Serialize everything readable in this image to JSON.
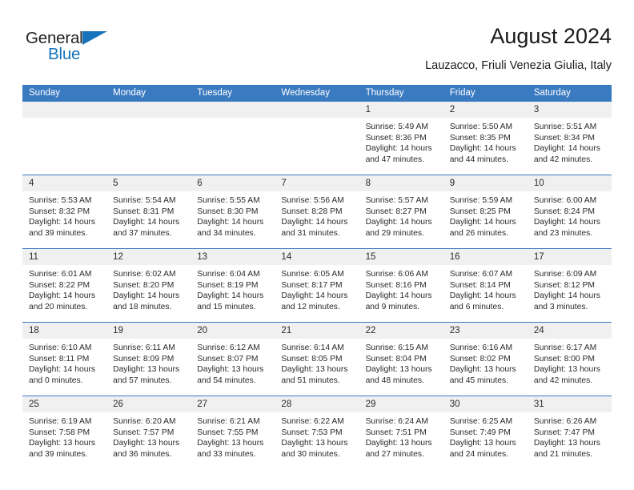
{
  "brand": {
    "name_part1": "General",
    "name_part2": "Blue",
    "accent_color": "#1473bb"
  },
  "header": {
    "title": "August 2024",
    "subtitle": "Lauzacco, Friuli Venezia Giulia, Italy"
  },
  "calendar": {
    "header_color": "#3a7ac0",
    "weekdays": [
      "Sunday",
      "Monday",
      "Tuesday",
      "Wednesday",
      "Thursday",
      "Friday",
      "Saturday"
    ],
    "labels": {
      "sunrise": "Sunrise:",
      "sunset": "Sunset:",
      "daylight": "Daylight:"
    },
    "weeks": [
      [
        {
          "date": "",
          "empty": true
        },
        {
          "date": "",
          "empty": true
        },
        {
          "date": "",
          "empty": true
        },
        {
          "date": "",
          "empty": true
        },
        {
          "date": "1",
          "sunrise": "Sunrise: 5:49 AM",
          "sunset": "Sunset: 8:36 PM",
          "daylight": "Daylight: 14 hours and 47 minutes."
        },
        {
          "date": "2",
          "sunrise": "Sunrise: 5:50 AM",
          "sunset": "Sunset: 8:35 PM",
          "daylight": "Daylight: 14 hours and 44 minutes."
        },
        {
          "date": "3",
          "sunrise": "Sunrise: 5:51 AM",
          "sunset": "Sunset: 8:34 PM",
          "daylight": "Daylight: 14 hours and 42 minutes."
        }
      ],
      [
        {
          "date": "4",
          "sunrise": "Sunrise: 5:53 AM",
          "sunset": "Sunset: 8:32 PM",
          "daylight": "Daylight: 14 hours and 39 minutes."
        },
        {
          "date": "5",
          "sunrise": "Sunrise: 5:54 AM",
          "sunset": "Sunset: 8:31 PM",
          "daylight": "Daylight: 14 hours and 37 minutes."
        },
        {
          "date": "6",
          "sunrise": "Sunrise: 5:55 AM",
          "sunset": "Sunset: 8:30 PM",
          "daylight": "Daylight: 14 hours and 34 minutes."
        },
        {
          "date": "7",
          "sunrise": "Sunrise: 5:56 AM",
          "sunset": "Sunset: 8:28 PM",
          "daylight": "Daylight: 14 hours and 31 minutes."
        },
        {
          "date": "8",
          "sunrise": "Sunrise: 5:57 AM",
          "sunset": "Sunset: 8:27 PM",
          "daylight": "Daylight: 14 hours and 29 minutes."
        },
        {
          "date": "9",
          "sunrise": "Sunrise: 5:59 AM",
          "sunset": "Sunset: 8:25 PM",
          "daylight": "Daylight: 14 hours and 26 minutes."
        },
        {
          "date": "10",
          "sunrise": "Sunrise: 6:00 AM",
          "sunset": "Sunset: 8:24 PM",
          "daylight": "Daylight: 14 hours and 23 minutes."
        }
      ],
      [
        {
          "date": "11",
          "sunrise": "Sunrise: 6:01 AM",
          "sunset": "Sunset: 8:22 PM",
          "daylight": "Daylight: 14 hours and 20 minutes."
        },
        {
          "date": "12",
          "sunrise": "Sunrise: 6:02 AM",
          "sunset": "Sunset: 8:20 PM",
          "daylight": "Daylight: 14 hours and 18 minutes."
        },
        {
          "date": "13",
          "sunrise": "Sunrise: 6:04 AM",
          "sunset": "Sunset: 8:19 PM",
          "daylight": "Daylight: 14 hours and 15 minutes."
        },
        {
          "date": "14",
          "sunrise": "Sunrise: 6:05 AM",
          "sunset": "Sunset: 8:17 PM",
          "daylight": "Daylight: 14 hours and 12 minutes."
        },
        {
          "date": "15",
          "sunrise": "Sunrise: 6:06 AM",
          "sunset": "Sunset: 8:16 PM",
          "daylight": "Daylight: 14 hours and 9 minutes."
        },
        {
          "date": "16",
          "sunrise": "Sunrise: 6:07 AM",
          "sunset": "Sunset: 8:14 PM",
          "daylight": "Daylight: 14 hours and 6 minutes."
        },
        {
          "date": "17",
          "sunrise": "Sunrise: 6:09 AM",
          "sunset": "Sunset: 8:12 PM",
          "daylight": "Daylight: 14 hours and 3 minutes."
        }
      ],
      [
        {
          "date": "18",
          "sunrise": "Sunrise: 6:10 AM",
          "sunset": "Sunset: 8:11 PM",
          "daylight": "Daylight: 14 hours and 0 minutes."
        },
        {
          "date": "19",
          "sunrise": "Sunrise: 6:11 AM",
          "sunset": "Sunset: 8:09 PM",
          "daylight": "Daylight: 13 hours and 57 minutes."
        },
        {
          "date": "20",
          "sunrise": "Sunrise: 6:12 AM",
          "sunset": "Sunset: 8:07 PM",
          "daylight": "Daylight: 13 hours and 54 minutes."
        },
        {
          "date": "21",
          "sunrise": "Sunrise: 6:14 AM",
          "sunset": "Sunset: 8:05 PM",
          "daylight": "Daylight: 13 hours and 51 minutes."
        },
        {
          "date": "22",
          "sunrise": "Sunrise: 6:15 AM",
          "sunset": "Sunset: 8:04 PM",
          "daylight": "Daylight: 13 hours and 48 minutes."
        },
        {
          "date": "23",
          "sunrise": "Sunrise: 6:16 AM",
          "sunset": "Sunset: 8:02 PM",
          "daylight": "Daylight: 13 hours and 45 minutes."
        },
        {
          "date": "24",
          "sunrise": "Sunrise: 6:17 AM",
          "sunset": "Sunset: 8:00 PM",
          "daylight": "Daylight: 13 hours and 42 minutes."
        }
      ],
      [
        {
          "date": "25",
          "sunrise": "Sunrise: 6:19 AM",
          "sunset": "Sunset: 7:58 PM",
          "daylight": "Daylight: 13 hours and 39 minutes."
        },
        {
          "date": "26",
          "sunrise": "Sunrise: 6:20 AM",
          "sunset": "Sunset: 7:57 PM",
          "daylight": "Daylight: 13 hours and 36 minutes."
        },
        {
          "date": "27",
          "sunrise": "Sunrise: 6:21 AM",
          "sunset": "Sunset: 7:55 PM",
          "daylight": "Daylight: 13 hours and 33 minutes."
        },
        {
          "date": "28",
          "sunrise": "Sunrise: 6:22 AM",
          "sunset": "Sunset: 7:53 PM",
          "daylight": "Daylight: 13 hours and 30 minutes."
        },
        {
          "date": "29",
          "sunrise": "Sunrise: 6:24 AM",
          "sunset": "Sunset: 7:51 PM",
          "daylight": "Daylight: 13 hours and 27 minutes."
        },
        {
          "date": "30",
          "sunrise": "Sunrise: 6:25 AM",
          "sunset": "Sunset: 7:49 PM",
          "daylight": "Daylight: 13 hours and 24 minutes."
        },
        {
          "date": "31",
          "sunrise": "Sunrise: 6:26 AM",
          "sunset": "Sunset: 7:47 PM",
          "daylight": "Daylight: 13 hours and 21 minutes."
        }
      ]
    ]
  }
}
